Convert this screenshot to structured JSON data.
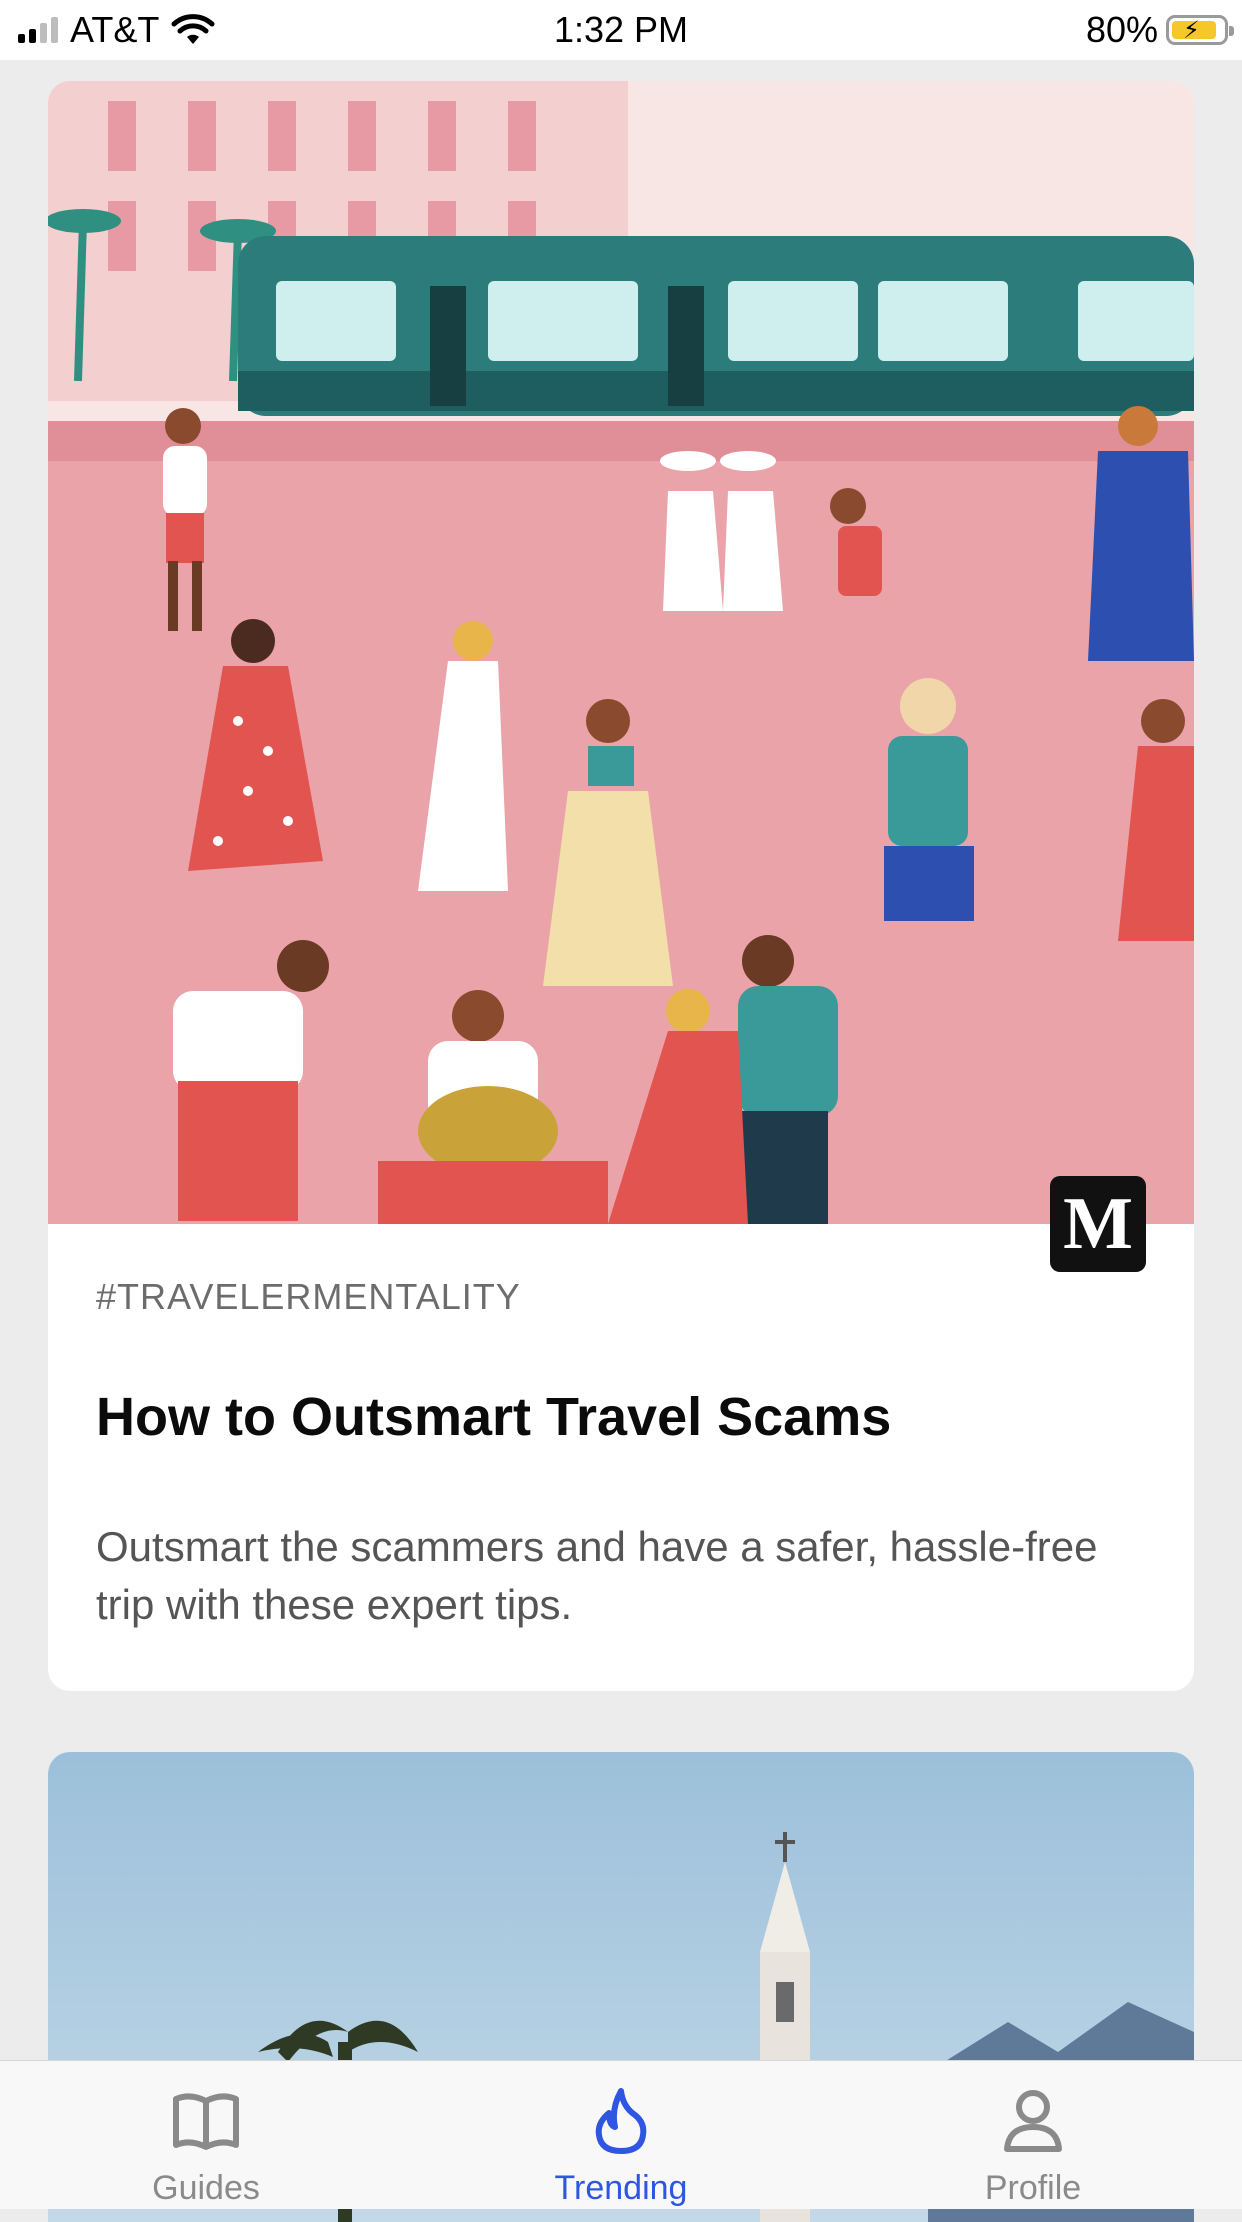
{
  "status_bar": {
    "carrier": "AT&T",
    "time": "1:32 PM",
    "battery": "80%"
  },
  "articles": [
    {
      "tag": "#TRAVELERMENTALITY",
      "title": "How to Outsmart Travel Scams",
      "description": "Outsmart the scammers and have a safer, hassle-free trip with these expert tips.",
      "source_badge": "M",
      "image": "illustration of a busy pink plaza with a teal tram and dancing people"
    },
    {
      "image": "photo of a blue sky with a white church tower, palm tree and mountains"
    }
  ],
  "tab_bar": {
    "tabs": [
      {
        "label": "Guides",
        "icon": "book-icon"
      },
      {
        "label": "Trending",
        "icon": "flame-icon",
        "active": true
      },
      {
        "label": "Profile",
        "icon": "person-icon"
      }
    ]
  },
  "colors": {
    "accent": "#2f56e0",
    "background": "#ececec",
    "tram": "#2c7c7c",
    "plaza": "#eaa3a8"
  }
}
